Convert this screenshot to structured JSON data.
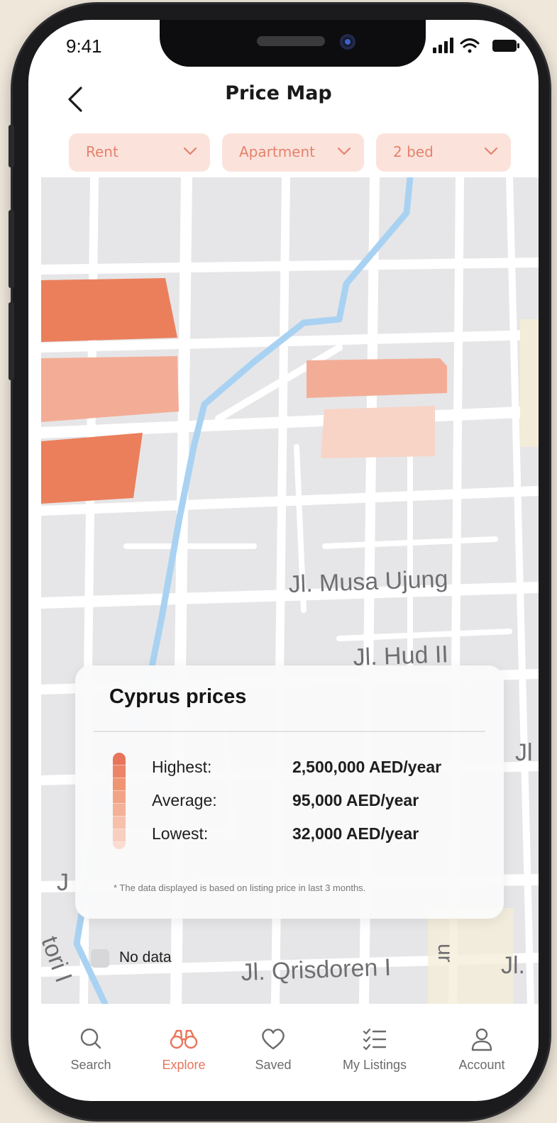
{
  "status": {
    "time": "9:41"
  },
  "header": {
    "title": "Price Map"
  },
  "filters": [
    {
      "label": "Rent"
    },
    {
      "label": "Apartment"
    },
    {
      "label": "2 bed"
    }
  ],
  "map": {
    "street_labels": [
      "Jl. Musa Ujung",
      "Jl. Hud II",
      "Jl. Qrisdoren I",
      "Jl",
      "Jl.",
      "J",
      "ur",
      "tori I"
    ]
  },
  "legend": {
    "title": "Cyprus prices",
    "rows": [
      {
        "label": "Highest:",
        "value": "2,500,000 AED/year"
      },
      {
        "label": "Average:",
        "value": "95,000 AED/year"
      },
      {
        "label": "Lowest:",
        "value": "32,000 AED/year"
      }
    ],
    "footnote": "* The data displayed is based on listing price in last 3 months.",
    "no_data_label": "No data"
  },
  "tabs": [
    {
      "label": "Search",
      "icon": "search-icon",
      "active": false
    },
    {
      "label": "Explore",
      "icon": "binoculars-icon",
      "active": true
    },
    {
      "label": "Saved",
      "icon": "heart-icon",
      "active": false
    },
    {
      "label": "My Listings",
      "icon": "checklist-icon",
      "active": false
    },
    {
      "label": "Account",
      "icon": "user-icon",
      "active": false
    }
  ],
  "colors": {
    "accent": "#e8755b",
    "filter_bg": "#fbe3dc",
    "high_price": "#eb7f5c",
    "mid_price": "#f3ad96",
    "low_price": "#f8d4c6",
    "water": "#a9d2f2",
    "no_data": "#d7d7d9"
  }
}
